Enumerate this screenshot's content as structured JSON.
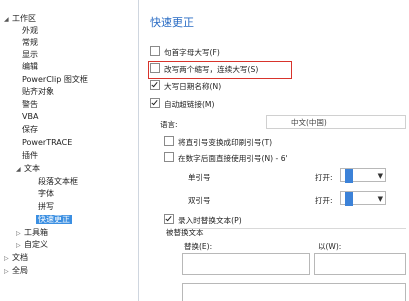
{
  "tree": {
    "items": [
      {
        "label": "工作区",
        "arrow": "◢"
      },
      {
        "label": "外观",
        "arrow": ""
      },
      {
        "label": "常规",
        "arrow": ""
      },
      {
        "label": "显示",
        "arrow": ""
      },
      {
        "label": "编辑",
        "arrow": ""
      },
      {
        "label": "PowerClip 图文框",
        "arrow": ""
      },
      {
        "label": "贴齐对象",
        "arrow": ""
      },
      {
        "label": "警告",
        "arrow": ""
      },
      {
        "label": "VBA",
        "arrow": ""
      },
      {
        "label": "保存",
        "arrow": ""
      },
      {
        "label": "PowerTRACE",
        "arrow": ""
      },
      {
        "label": "插件",
        "arrow": ""
      },
      {
        "label": "文本",
        "arrow": "◢"
      },
      {
        "label": "段落文本框",
        "arrow": ""
      },
      {
        "label": "字体",
        "arrow": ""
      },
      {
        "label": "拼写",
        "arrow": ""
      },
      {
        "label": "快速更正",
        "arrow": ""
      },
      {
        "label": "工具箱",
        "arrow": "▷"
      },
      {
        "label": "自定义",
        "arrow": "▷"
      },
      {
        "label": "文档",
        "arrow": "▷"
      },
      {
        "label": "全局",
        "arrow": "▷"
      }
    ]
  },
  "panel": {
    "title": "快速更正",
    "opt_capitalize_first": "句首字母大写(F)",
    "opt_two_initial_caps": "改写两个缩写，连续大写(S)",
    "opt_capitalize_days": "大写日期名称(N)",
    "opt_hyperlink": "自动超链接(M)",
    "language_label": "语言:",
    "language_value": "中文(中国)",
    "opt_straight_quotes": "将直引号变换成印刷引号(T)",
    "opt_numbers_quotes": "在数字后面直接使用引号(N) - 6'",
    "single_quote_label": "单引号",
    "double_quote_label": "双引号",
    "open_label_1": "打开:",
    "open_label_2": "打开:",
    "opt_replace_text": "录入时替换文本(P)",
    "replaced_text_label": "被替换文本",
    "replace_label": "替换(E):",
    "with_label": "以(W):"
  },
  "colors": {
    "accent": "#2a6cc4",
    "highlight": "#d8342c",
    "selected": "#3b8fe2"
  }
}
